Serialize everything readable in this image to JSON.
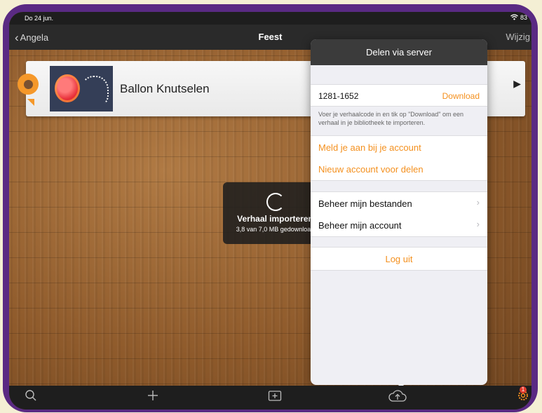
{
  "status_bar": {
    "time": "Do 24 jun.",
    "battery": "83"
  },
  "nav": {
    "back_label": "Angela",
    "title": "Feest",
    "edit_label": "Wijzig"
  },
  "story": {
    "title": "Ballon Knutselen"
  },
  "hud": {
    "title": "Verhaal importeren",
    "progress_text": "3,8 van 7,0 MB gedownload"
  },
  "popover": {
    "title": "Delen via server",
    "story_code": "1281-1652",
    "download_label": "Download",
    "hint": "Voer je verhaalcode in en tik op \"Download\" om een verhaal in je bibliotheek te importeren.",
    "login_label": "Meld je aan bij je account",
    "new_account_label": "Nieuw account voor delen",
    "manage_files_label": "Beheer mijn bestanden",
    "manage_account_label": "Beheer mijn account",
    "logout_label": "Log uit"
  },
  "tab_bar": {
    "icons": [
      "search-icon",
      "plus-icon",
      "new-folder-icon",
      "cloud-upload-icon",
      "settings-icon"
    ],
    "settings_badge": "1"
  },
  "colors": {
    "accent": "#f4901e",
    "device_frame": "#5a2a83",
    "popover_header": "#3b3b3b"
  }
}
